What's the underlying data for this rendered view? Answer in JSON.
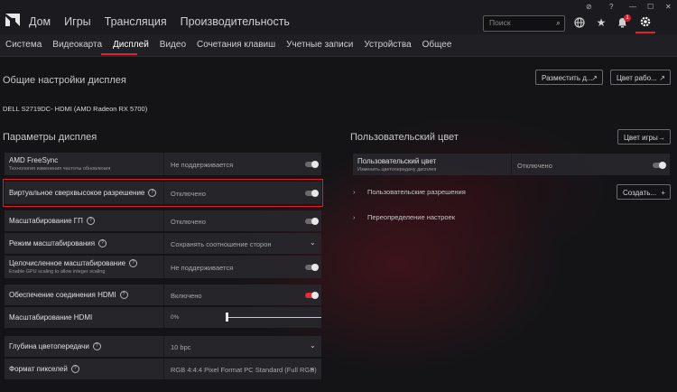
{
  "topbar": {
    "nav": [
      "Дом",
      "Игры",
      "Трансляция",
      "Производительность"
    ],
    "search_placeholder": "Поиск",
    "notification_count": "1",
    "window_controls": [
      "⊘",
      "?",
      "—",
      "☐",
      "✕"
    ]
  },
  "subnav": {
    "tabs": [
      "Система",
      "Видеокарта",
      "Дисплей",
      "Видео",
      "Сочетания клавиш",
      "Учетные записи",
      "Устройства",
      "Общее"
    ],
    "active": "Дисплей"
  },
  "general": {
    "title": "Общие настройки дисплея",
    "btn_place": "Разместить д...",
    "btn_color": "Цвет рабо...",
    "monitor": "DELL S2719DC- HDMI (AMD Radeon RX 5700)"
  },
  "display_params": {
    "title": "Параметры дисплея",
    "rows": [
      {
        "label": "AMD FreeSync",
        "sub": "Технология изменения частоты обновления",
        "value": "Не поддерживается"
      },
      {
        "label": "Виртуальное сверхвысокое разрешение",
        "value": "Отключено"
      },
      {
        "label": "Масштабирование ГП",
        "value": "Отключено"
      },
      {
        "label": "Режим масштабирования",
        "value": "Сохранять соотношение сторон"
      },
      {
        "label": "Целочисленное масштабирование",
        "sub": "Enable GPU scaling to allow integer scaling",
        "value": "Не поддерживается"
      },
      {
        "label": "Обеспечение соединения HDMI",
        "value": "Включено"
      },
      {
        "label": "Масштабирование HDMI",
        "value": "0%",
        "slider_value": 0
      },
      {
        "label": "Глубина цветопередачи",
        "value": "10 bpc"
      },
      {
        "label": "Формат пикселей",
        "value": "RGB 4:4:4 Pixel Format PC Standard (Full RGB)"
      }
    ]
  },
  "custom_color": {
    "title": "Пользовательский цвет",
    "btn_game_color": "Цвет игры",
    "row_label": "Пользовательский цвет",
    "row_sub": "Изменить цветопередачу дисплея",
    "row_value": "Отключено",
    "custom_res": "Пользовательские разрешения",
    "btn_create": "Создать...",
    "override": "Переопределение настроек"
  },
  "colors": {
    "accent": "#e0222f",
    "highlight": "#e11b27"
  }
}
